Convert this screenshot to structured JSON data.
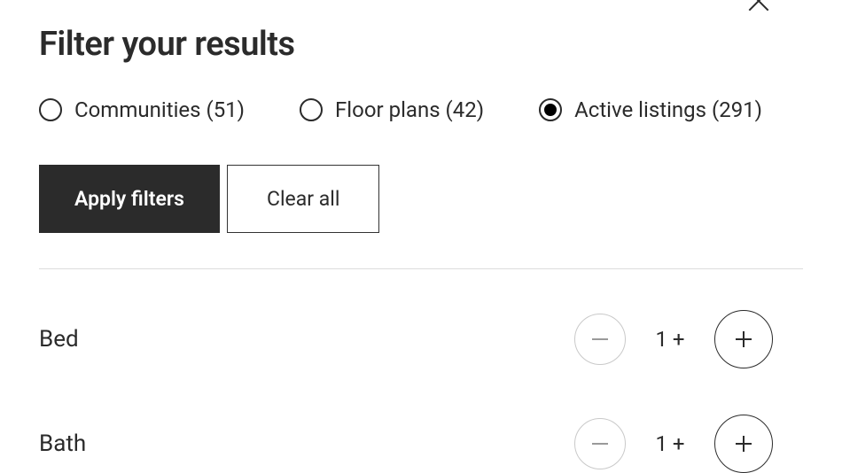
{
  "title": "Filter your results",
  "radios": [
    {
      "label": "Communities (51)",
      "selected": false
    },
    {
      "label": "Floor plans (42)",
      "selected": false
    },
    {
      "label": "Active listings (291)",
      "selected": true
    }
  ],
  "buttons": {
    "apply": "Apply filters",
    "clear": "Clear all"
  },
  "steppers": [
    {
      "label": "Bed",
      "value": "1 +"
    },
    {
      "label": "Bath",
      "value": "1 +"
    }
  ]
}
